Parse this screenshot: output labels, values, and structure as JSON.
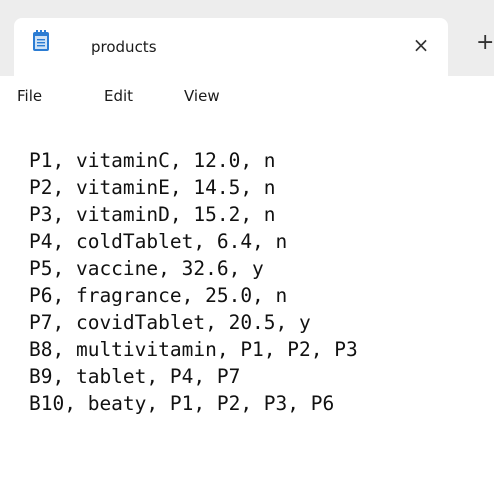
{
  "tab": {
    "title": "products",
    "close_glyph": "×",
    "new_tab_glyph": "+",
    "icon": "notepad-icon"
  },
  "menu": {
    "items": [
      "File",
      "Edit",
      "View"
    ]
  },
  "editor": {
    "lines": [
      "P1, vitaminC, 12.0, n",
      "P2, vitaminE, 14.5, n",
      "P3, vitaminD, 15.2, n",
      "P4, coldTablet, 6.4, n",
      "P5, vaccine, 32.6, y",
      "P6, fragrance, 25.0, n",
      "P7, covidTablet, 20.5, y",
      "B8, multivitamin, P1, P2, P3",
      "B9, tablet, P4, P7",
      "B10, beaty, P1, P2, P3, P6"
    ]
  },
  "colors": {
    "titlebar_bg": "#ededed",
    "tab_bg": "#ffffff",
    "icon_blue": "#2b7cd3",
    "icon_light": "#cfe3f7"
  }
}
